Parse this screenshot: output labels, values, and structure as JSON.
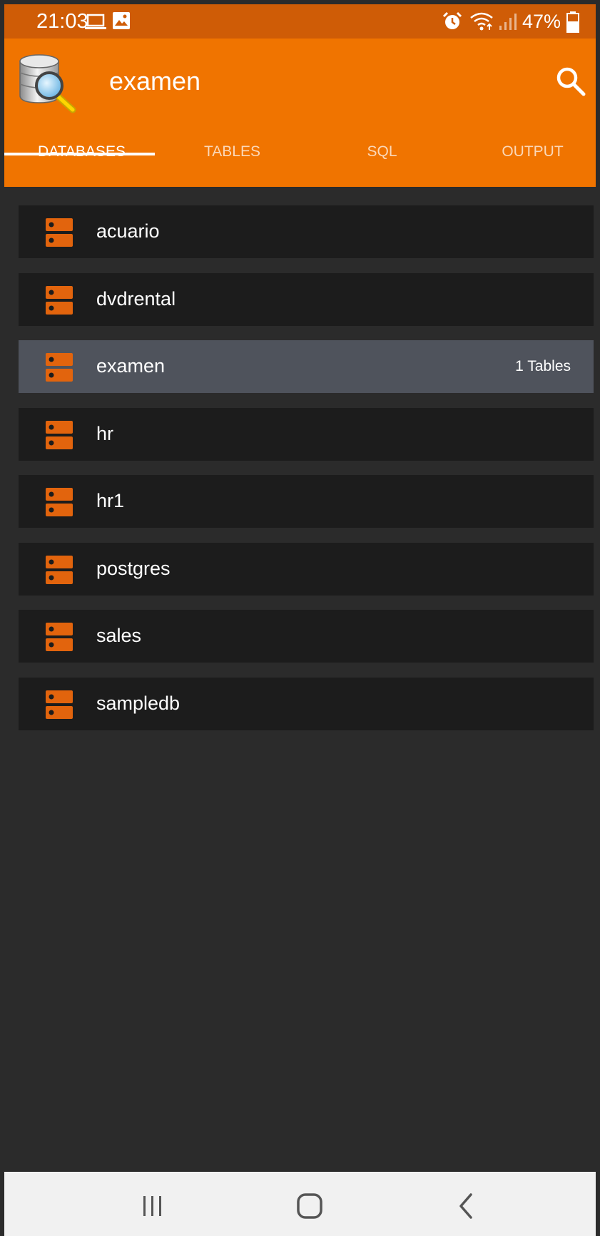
{
  "status_bar": {
    "time": "21:03",
    "battery": "47%",
    "icons": [
      "laptop-icon",
      "image-icon",
      "alarm-icon",
      "wifi-icon",
      "signal-icon",
      "battery-icon"
    ]
  },
  "app_bar": {
    "title": "examen",
    "logo": "database-search-logo",
    "search_icon": "search-icon"
  },
  "tabs": [
    {
      "label": "DATABASES",
      "active": true
    },
    {
      "label": "TABLES",
      "active": false
    },
    {
      "label": "SQL",
      "active": false
    },
    {
      "label": "OUTPUT",
      "active": false
    }
  ],
  "databases": [
    {
      "name": "acuario",
      "count": ""
    },
    {
      "name": "dvdrental",
      "count": ""
    },
    {
      "name": "examen",
      "count": "1 Tables",
      "selected": true
    },
    {
      "name": "hr",
      "count": ""
    },
    {
      "name": "hr1",
      "count": ""
    },
    {
      "name": "postgres",
      "count": ""
    },
    {
      "name": "sales",
      "count": ""
    },
    {
      "name": "sampledb",
      "count": ""
    }
  ],
  "nav_bar": {
    "buttons": [
      "recent-apps-icon",
      "home-icon",
      "back-icon"
    ]
  },
  "colors": {
    "status_bar": "#cf5c06",
    "app_bar": "#f07400",
    "list_bg": "#2b2b2b",
    "item_bg": "#1c1c1c",
    "item_selected_bg": "#4f535c",
    "db_icon": "#e2640d"
  }
}
